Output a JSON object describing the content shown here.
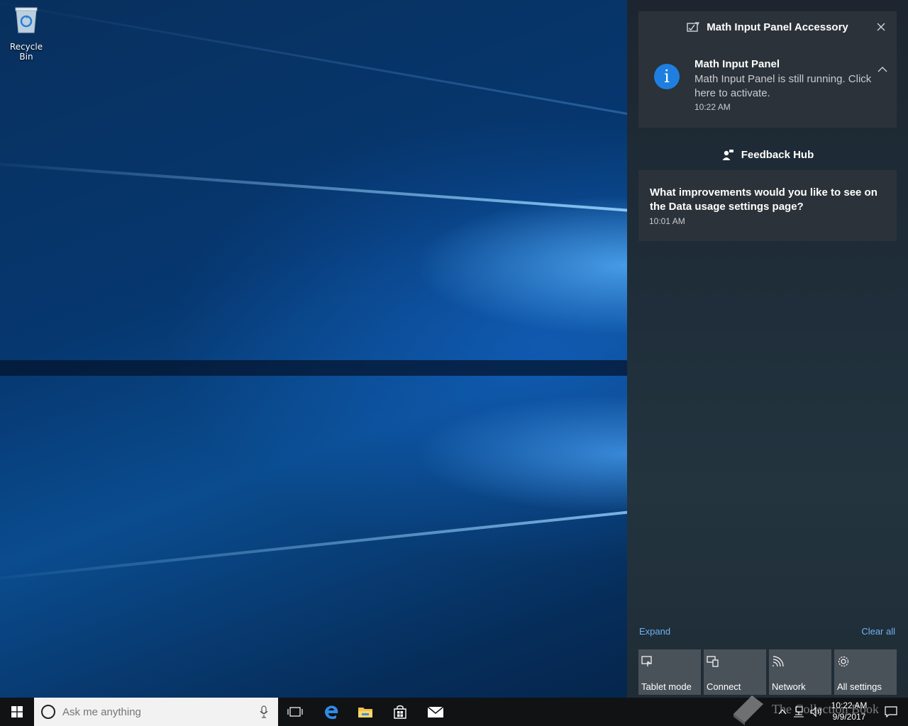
{
  "desktop": {
    "recycle_bin_label": "Recycle Bin"
  },
  "action_center": {
    "groups": [
      {
        "app": "Math Input Panel Accessory",
        "icon": "math-panel-icon",
        "notifications": [
          {
            "title": "Math Input Panel",
            "body": "Math Input Panel is still running. Click here to activate.",
            "time": "10:22 AM",
            "icon": "info-icon"
          }
        ]
      },
      {
        "app": "Feedback Hub",
        "icon": "feedback-hub-icon",
        "notifications": [
          {
            "body": "What improvements would you like to see on the Data usage settings page?",
            "time": "10:01 AM"
          }
        ]
      }
    ],
    "expand_label": "Expand",
    "clear_all_label": "Clear all",
    "quick_actions": [
      {
        "label": "Tablet mode",
        "icon": "tablet-mode-icon"
      },
      {
        "label": "Connect",
        "icon": "connect-icon"
      },
      {
        "label": "Network",
        "icon": "network-icon"
      },
      {
        "label": "All settings",
        "icon": "gear-icon"
      }
    ]
  },
  "taskbar": {
    "search_placeholder": "Ask me anything",
    "pinned": [
      "task-view-icon",
      "edge-icon",
      "file-explorer-icon",
      "store-icon",
      "mail-icon"
    ],
    "clock": {
      "time": "10:22 AM",
      "date": "9/9/2017"
    }
  },
  "watermark": {
    "text": "The Collection Book"
  },
  "colors": {
    "accent": "#1e7fe0",
    "link": "#6fb2f2",
    "card_bg": "#2b3239",
    "tile_bg": "#4a5259",
    "taskbar_bg": "#101214"
  }
}
